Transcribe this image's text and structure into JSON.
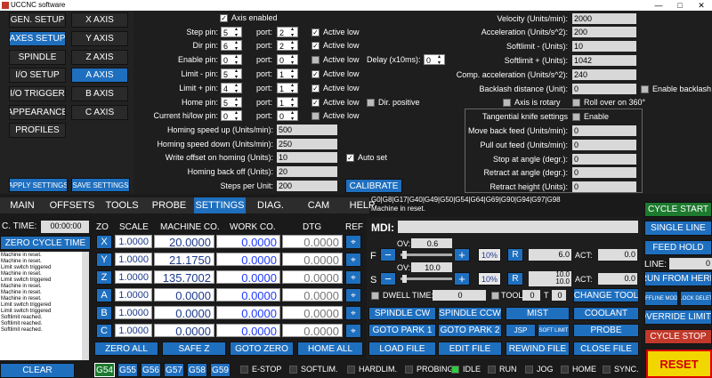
{
  "window": {
    "title": "UCCNC software",
    "min": "—",
    "max": "□",
    "close": "✕"
  },
  "sidebar": {
    "items": [
      [
        "GEN. SETUP",
        "X AXIS"
      ],
      [
        "AXES SETUP",
        "Y AXIS"
      ],
      [
        "SPINDLE",
        "Z AXIS"
      ],
      [
        "I/O SETUP",
        "A AXIS"
      ],
      [
        "I/O TRIGGER",
        "B AXIS"
      ],
      [
        "APPEARANCE",
        "C AXIS"
      ],
      [
        "PROFILES",
        ""
      ]
    ],
    "apply": "APPLY SETTINGS",
    "save": "SAVE SETTINGS"
  },
  "axis": {
    "enabled_label": "Axis enabled",
    "step": {
      "label": "Step pin:",
      "pin": "5",
      "port_label": "port:",
      "port": "2",
      "al": "Active low"
    },
    "dir": {
      "label": "Dir pin:",
      "pin": "6",
      "port_label": "port:",
      "port": "2",
      "al": "Active low"
    },
    "enable": {
      "label": "Enable pin:",
      "pin": "0",
      "port_label": "port:",
      "port": "0",
      "al": "Active low",
      "delay_label": "Delay (x10ms):",
      "delay": "0"
    },
    "limm": {
      "label": "Limit - pin:",
      "pin": "5",
      "port_label": "port:",
      "port": "1",
      "al": "Active low"
    },
    "limp": {
      "label": "Limit + pin:",
      "pin": "4",
      "port_label": "port:",
      "port": "1",
      "al": "Active low"
    },
    "home": {
      "label": "Home pin:",
      "pin": "5",
      "port_label": "port:",
      "port": "1",
      "al": "Active low",
      "dirpos": "Dir. positive"
    },
    "hilow": {
      "label": "Current hi/low pin:",
      "pin": "0",
      "port_label": "port:",
      "port": "0",
      "al": "Active low"
    },
    "homing_speed_up": {
      "label": "Homing speed up (Units/min):",
      "value": "500"
    },
    "homing_speed_down": {
      "label": "Homing speed down (Units/min):",
      "value": "250"
    },
    "write_offset": {
      "label": "Write offset on homing (Units):",
      "value": "10",
      "autoset": "Auto set"
    },
    "homing_back": {
      "label": "Homing back off (Units):",
      "value": "20"
    },
    "steps": {
      "label": "Steps per Unit:",
      "value": "200"
    },
    "calibrate": "CALIBRATE",
    "velocity": {
      "label": "Velocity (Units/min):",
      "value": "2000"
    },
    "accel": {
      "label": "Acceleration (Units/s^2):",
      "value": "200"
    },
    "softm": {
      "label": "Softlimit - (Units):",
      "value": "10"
    },
    "softp": {
      "label": "Softlimit + (Units):",
      "value": "1042"
    },
    "compacc": {
      "label": "Comp. acceleration (Units/s^2):",
      "value": "240"
    },
    "backlash": {
      "label": "Backlash distance (Unit):",
      "value": "0",
      "enable": "Enable backlash"
    },
    "rotary": "Axis is rotary",
    "rollover": "Roll over on 360°",
    "tangential": {
      "label": "Tangential knife settings",
      "enable": "Enable"
    },
    "moveback": {
      "label": "Move back feed (Units/min):",
      "value": "0"
    },
    "pullout": {
      "label": "Pull out feed (Units/min):",
      "value": "0"
    },
    "stopat": {
      "label": "Stop at angle (degr.):",
      "value": "0"
    },
    "retractat": {
      "label": "Retract at angle (degr.):",
      "value": "0"
    },
    "retracth": {
      "label": "Retract height (Units):",
      "value": "0"
    }
  },
  "gcode": {
    "modal": "G0|G8|G17|G40|G49|G50|G54|G64|G69|G90|G94|G97|G98",
    "msg": "Machine in reset."
  },
  "tabs": [
    "MAIN",
    "OFFSETS",
    "TOOLS",
    "PROBE",
    "SETTINGS",
    "DIAG.",
    "CAM",
    "HELP"
  ],
  "left": {
    "ctime_label": "C. TIME:",
    "ctime": "00:00:00",
    "zero_cycle": "ZERO CYCLE TIME",
    "log": [
      "Machine in reset.",
      "Machine in reset.",
      "Limit switch triggered",
      "Machine in reset.",
      "Limit switch triggered",
      "Machine in reset.",
      "Machine in reset.",
      "Machine in reset.",
      "Limit switch triggered",
      "Limit switch triggered",
      "Softlimit reached.",
      "Softlimit reached.",
      "Softlimit reached."
    ],
    "clear": "CLEAR"
  },
  "dro": {
    "headers": {
      "zo": "ZO",
      "scale": "SCALE",
      "mach": "MACHINE CO.",
      "work": "WORK CO.",
      "dtg": "DTG",
      "ref": "REF"
    },
    "rows": [
      {
        "axis": "X",
        "scale": "1.0000",
        "mach": "20.0000",
        "work": "0.0000",
        "dtg": "0.0000"
      },
      {
        "axis": "Y",
        "scale": "1.0000",
        "mach": "21.1750",
        "work": "0.0000",
        "dtg": "0.0000"
      },
      {
        "axis": "Z",
        "scale": "1.0000",
        "mach": "135.7002",
        "work": "0.0000",
        "dtg": "0.0000"
      },
      {
        "axis": "A",
        "scale": "1.0000",
        "mach": "0.0000",
        "work": "0.0000",
        "dtg": "0.0000"
      },
      {
        "axis": "B",
        "scale": "1.0000",
        "mach": "0.0000",
        "work": "0.0000",
        "dtg": "0.0000"
      },
      {
        "axis": "C",
        "scale": "1.0000",
        "mach": "0.0000",
        "work": "0.0000",
        "dtg": "0.0000"
      }
    ],
    "zero_all": "ZERO ALL",
    "safe_z": "SAFE Z",
    "goto_zero": "GOTO ZERO",
    "home_all": "HOME ALL"
  },
  "mdi": {
    "label": "MDI:",
    "f": {
      "label": "F",
      "ov_label": "OV:",
      "ov": "0.6",
      "minus": "−",
      "plus": "+",
      "pct": "10%",
      "r": "R",
      "value": "6.0",
      "act_label": "ACT:",
      "act": "0.0"
    },
    "s": {
      "label": "S",
      "ov_label": "OV:",
      "ov": "10.0",
      "minus": "−",
      "plus": "+",
      "pct": "10%",
      "r": "R",
      "value1": "10.0",
      "value2": "10.0",
      "act_label": "ACT:",
      "act": "0.0"
    },
    "dwell_label": "DWELL TIME:",
    "dwell": "0",
    "tool_label": "TOOL:",
    "tool": "0",
    "t_label": "T",
    "t": "0",
    "change_tool": "CHANGE TOOL",
    "buttons": [
      [
        "SPINDLE CW",
        "SPINDLE CCW",
        "MIST",
        "COOLANT"
      ],
      [
        "GOTO PARK 1",
        "GOTO PARK 2",
        "JSP",
        "SOFT LIMIT",
        "PROBE"
      ],
      [
        "LOAD FILE",
        "EDIT FILE",
        "REWIND FILE",
        "CLOSE FILE"
      ]
    ]
  },
  "right": {
    "cycle_start": "CYCLE START",
    "single_line": "SINGLE LINE",
    "feed_hold": "FEED HOLD",
    "line_label": "LINE:",
    "line": "0",
    "run_from": "RUN FROM HERE",
    "offline": "OFFLINE MODE",
    "block_del": "BLOCK DELETE",
    "override": "OVERRIDE LIMITS",
    "cycle_stop": "CYCLE STOP",
    "reset": "RESET"
  },
  "bottom": {
    "g_buttons": [
      "G54",
      "G55",
      "G56",
      "G57",
      "G58",
      "G59"
    ],
    "status": [
      {
        "label": "E-STOP",
        "on": false
      },
      {
        "label": "SOFTLIM.",
        "on": false
      },
      {
        "label": "HARDLIM.",
        "on": false
      },
      {
        "label": "PROBING",
        "on": false
      },
      {
        "label": "IDLE",
        "on": true
      },
      {
        "label": "RUN",
        "on": false
      },
      {
        "label": "JOG",
        "on": false
      },
      {
        "label": "HOME",
        "on": false
      },
      {
        "label": "SYNC.",
        "on": false
      }
    ]
  },
  "colors": {
    "accent": "#1f6fbf",
    "green": "#1d7a2e",
    "red": "#c0392b",
    "yellow": "#f2d600"
  }
}
